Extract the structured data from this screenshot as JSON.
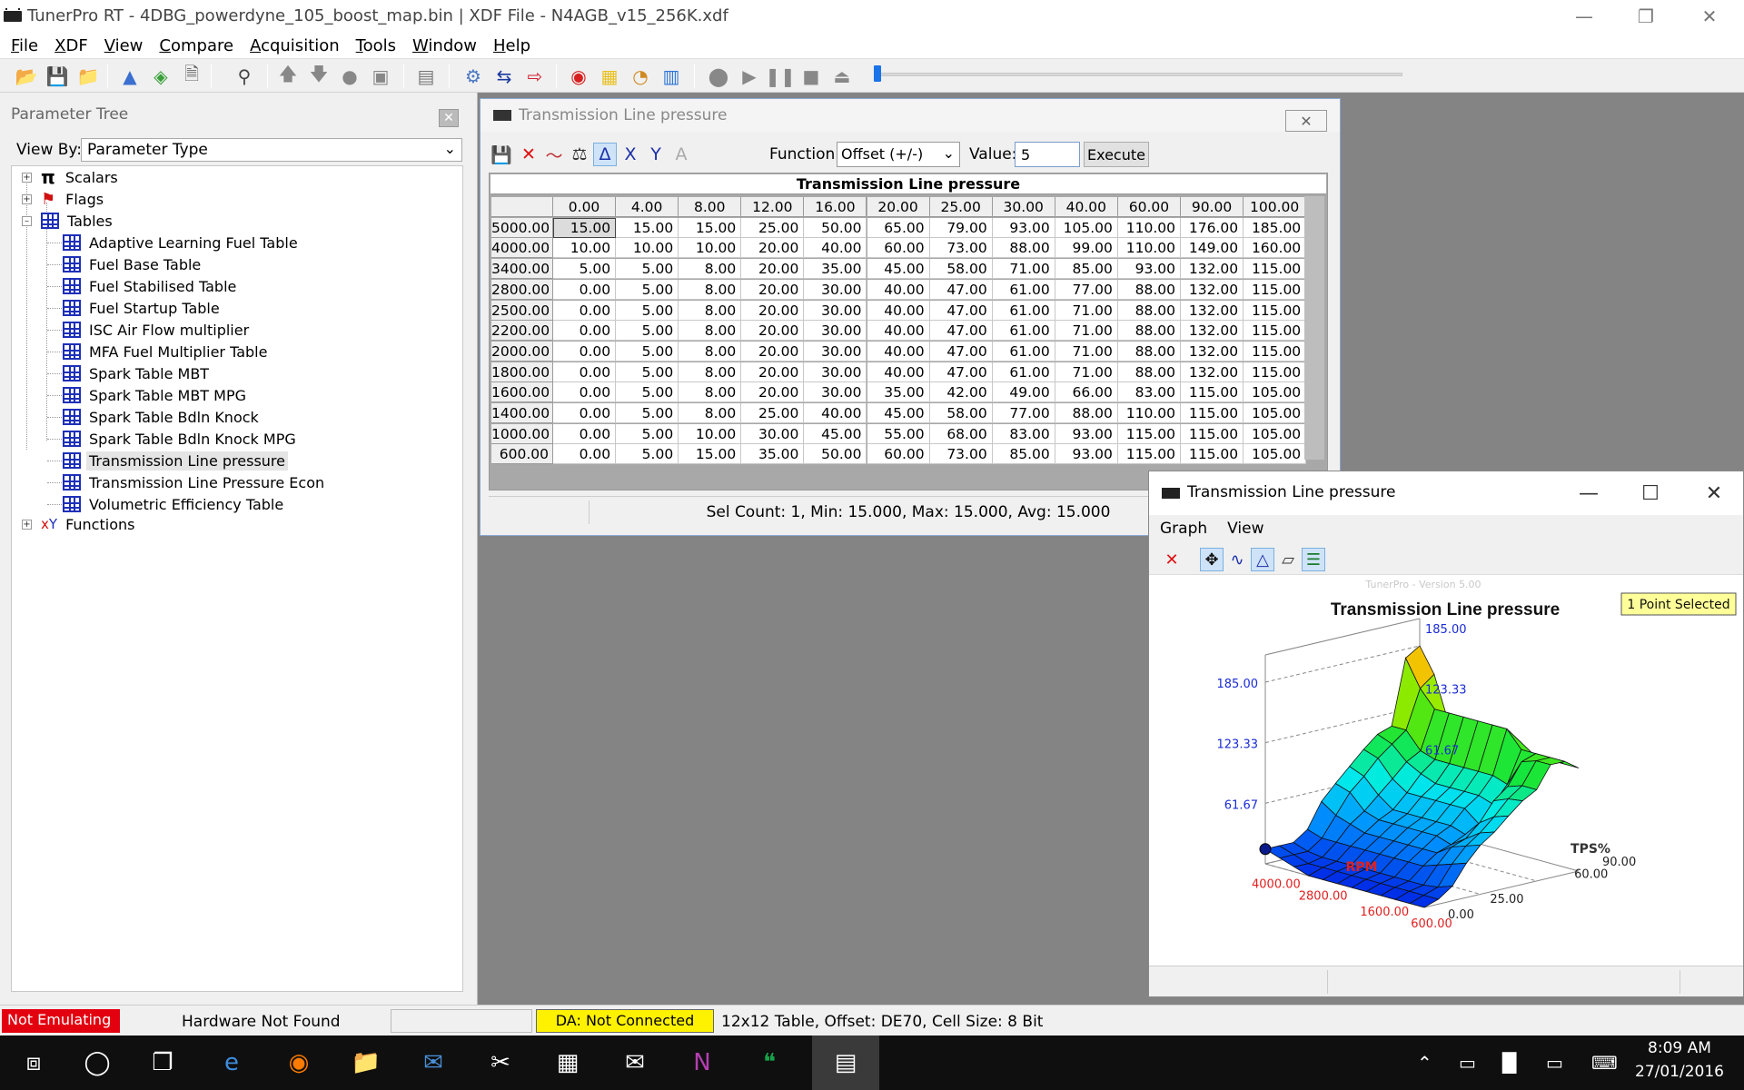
{
  "app": {
    "title": "TunerPro RT - 4DBG_powerdyne_105_boost_map.bin | XDF File - N4AGB_v15_256K.xdf"
  },
  "menu": [
    "File",
    "XDF",
    "View",
    "Compare",
    "Acquisition",
    "Tools",
    "Window",
    "Help"
  ],
  "param_tree": {
    "title": "Parameter Tree",
    "view_by_label": "View By:",
    "view_by_value": "Parameter Type",
    "groups": {
      "scalars": "Scalars",
      "flags": "Flags",
      "tables": "Tables",
      "functions": "Functions"
    },
    "tables": [
      "Adaptive Learning Fuel Table",
      "Fuel Base Table",
      "Fuel Stabilised Table",
      "Fuel Startup Table",
      "ISC Air Flow multiplier",
      "MFA Fuel Multiplier Table",
      "Spark Table MBT",
      "Spark Table MBT MPG",
      "Spark Table Bdln Knock",
      "Spark Table Bdln Knock MPG",
      "Transmission Line pressure",
      "Transmission Line Pressure Econ",
      "Volumetric Efficiency Table"
    ],
    "selected_index": 10
  },
  "table_window": {
    "title": "Transmission Line pressure",
    "function_label": "Function:",
    "function_value": "Offset (+/-)",
    "value_label": "Value:",
    "value": "5",
    "execute_label": "Execute",
    "grid_title": "Transmission Line pressure",
    "col_headers": [
      "0.00",
      "4.00",
      "8.00",
      "12.00",
      "16.00",
      "20.00",
      "25.00",
      "30.00",
      "40.00",
      "60.00",
      "90.00",
      "100.00"
    ],
    "row_headers": [
      "5000.00",
      "4000.00",
      "3400.00",
      "2800.00",
      "2500.00",
      "2200.00",
      "2000.00",
      "1800.00",
      "1600.00",
      "1400.00",
      "1000.00",
      "600.00"
    ],
    "rows": [
      [
        "15.00",
        "15.00",
        "15.00",
        "25.00",
        "50.00",
        "65.00",
        "79.00",
        "93.00",
        "105.00",
        "110.00",
        "176.00",
        "185.00"
      ],
      [
        "10.00",
        "10.00",
        "10.00",
        "20.00",
        "40.00",
        "60.00",
        "73.00",
        "88.00",
        "99.00",
        "110.00",
        "149.00",
        "160.00"
      ],
      [
        "5.00",
        "5.00",
        "8.00",
        "20.00",
        "35.00",
        "45.00",
        "58.00",
        "71.00",
        "85.00",
        "93.00",
        "132.00",
        "115.00"
      ],
      [
        "0.00",
        "5.00",
        "8.00",
        "20.00",
        "30.00",
        "40.00",
        "47.00",
        "61.00",
        "77.00",
        "88.00",
        "132.00",
        "115.00"
      ],
      [
        "0.00",
        "5.00",
        "8.00",
        "20.00",
        "30.00",
        "40.00",
        "47.00",
        "61.00",
        "71.00",
        "88.00",
        "132.00",
        "115.00"
      ],
      [
        "0.00",
        "5.00",
        "8.00",
        "20.00",
        "30.00",
        "40.00",
        "47.00",
        "61.00",
        "71.00",
        "88.00",
        "132.00",
        "115.00"
      ],
      [
        "0.00",
        "5.00",
        "8.00",
        "20.00",
        "30.00",
        "40.00",
        "47.00",
        "61.00",
        "71.00",
        "88.00",
        "132.00",
        "115.00"
      ],
      [
        "0.00",
        "5.00",
        "8.00",
        "20.00",
        "30.00",
        "40.00",
        "47.00",
        "61.00",
        "71.00",
        "88.00",
        "132.00",
        "115.00"
      ],
      [
        "0.00",
        "5.00",
        "8.00",
        "20.00",
        "30.00",
        "35.00",
        "42.00",
        "49.00",
        "66.00",
        "83.00",
        "115.00",
        "105.00"
      ],
      [
        "0.00",
        "5.00",
        "8.00",
        "25.00",
        "40.00",
        "45.00",
        "58.00",
        "77.00",
        "88.00",
        "110.00",
        "115.00",
        "105.00"
      ],
      [
        "0.00",
        "5.00",
        "10.00",
        "30.00",
        "45.00",
        "55.00",
        "68.00",
        "83.00",
        "93.00",
        "115.00",
        "115.00",
        "105.00"
      ],
      [
        "0.00",
        "5.00",
        "15.00",
        "35.00",
        "50.00",
        "60.00",
        "73.00",
        "85.00",
        "93.00",
        "115.00",
        "115.00",
        "105.00"
      ]
    ],
    "selected_cell": [
      0,
      0
    ],
    "status": "Sel Count: 1, Min: 15.000, Max: 15.000, Avg: 15.000"
  },
  "graph_window": {
    "title": "Transmission Line pressure",
    "menu": [
      "Graph",
      "View"
    ],
    "watermark": "TunerPro - Version 5.00",
    "plot_title": "Transmission Line pressure",
    "selection_badge": "1 Point Selected",
    "z_ticks_left": [
      "185.00",
      "123.33",
      "61.67"
    ],
    "z_ticks_right": [
      "185.00",
      "123.33",
      "61.67"
    ],
    "rpm_ticks": [
      "4000.00",
      "2800.00",
      "1600.00",
      "600.00"
    ],
    "tps_ticks": [
      "0.00",
      "25.00",
      "60.00",
      "90.00"
    ],
    "x_label": "RPM",
    "y_label": "TPS%"
  },
  "statusbar": {
    "emulation": "Not Emulating",
    "hardware": "Hardware Not Found",
    "da": "DA: Not Connected",
    "table_info": "12x12 Table, Offset: DE70,  Cell Size: 8 Bit"
  },
  "taskbar": {
    "time": "8:09 AM",
    "date": "27/01/2016"
  },
  "colors": {
    "workspace": "#848484",
    "not_emulating": "#e3000f",
    "da_status": "#fff200",
    "tree_icon": "#1d2fb8"
  }
}
